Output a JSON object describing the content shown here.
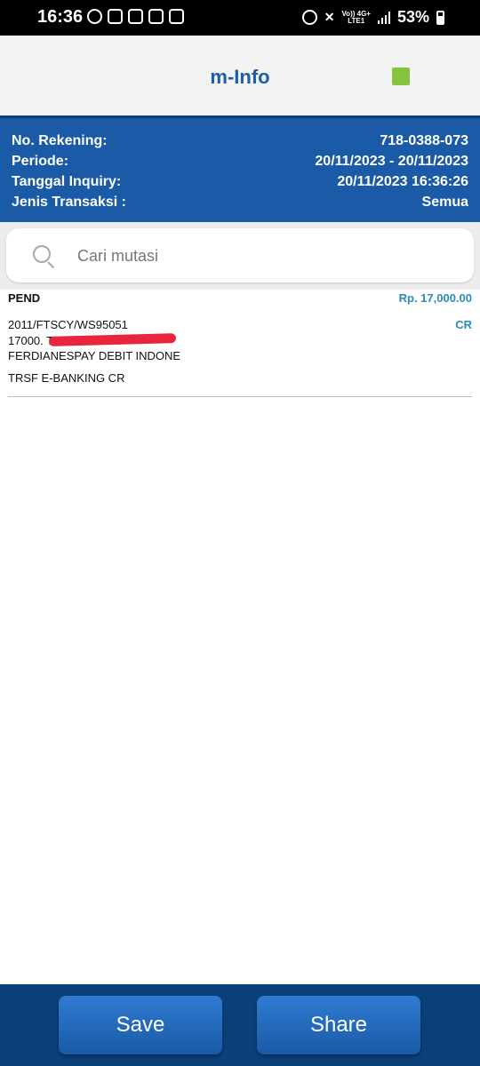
{
  "status_bar": {
    "time": "16:36",
    "network_top": "Vo)) 4G+",
    "network_bottom": "LTE1",
    "battery": "53%"
  },
  "header": {
    "title": "m-Info",
    "indicator_color": "#86c440"
  },
  "account_info": {
    "rows": [
      {
        "label": "No. Rekening:",
        "value": "718-0388-073"
      },
      {
        "label": "Periode:",
        "value": "20/11/2023 - 20/11/2023"
      },
      {
        "label": "Tanggal Inquiry:",
        "value": "20/11/2023 16:36:26"
      },
      {
        "label": "Jenis Transaksi :",
        "value": "Semua"
      }
    ]
  },
  "search": {
    "placeholder": "Cari mutasi",
    "value": ""
  },
  "transactions": [
    {
      "status": "PEND",
      "amount": "Rp. 17,000.00",
      "reference": "2011/FTSCY/WS95051",
      "type": "CR",
      "description": "17000.                                   TRFDN-REZA\nFERDIANESPAY DEBIT INDONE",
      "category": "TRSF E-BANKING CR"
    }
  ],
  "actions": {
    "save": "Save",
    "share": "Share"
  }
}
